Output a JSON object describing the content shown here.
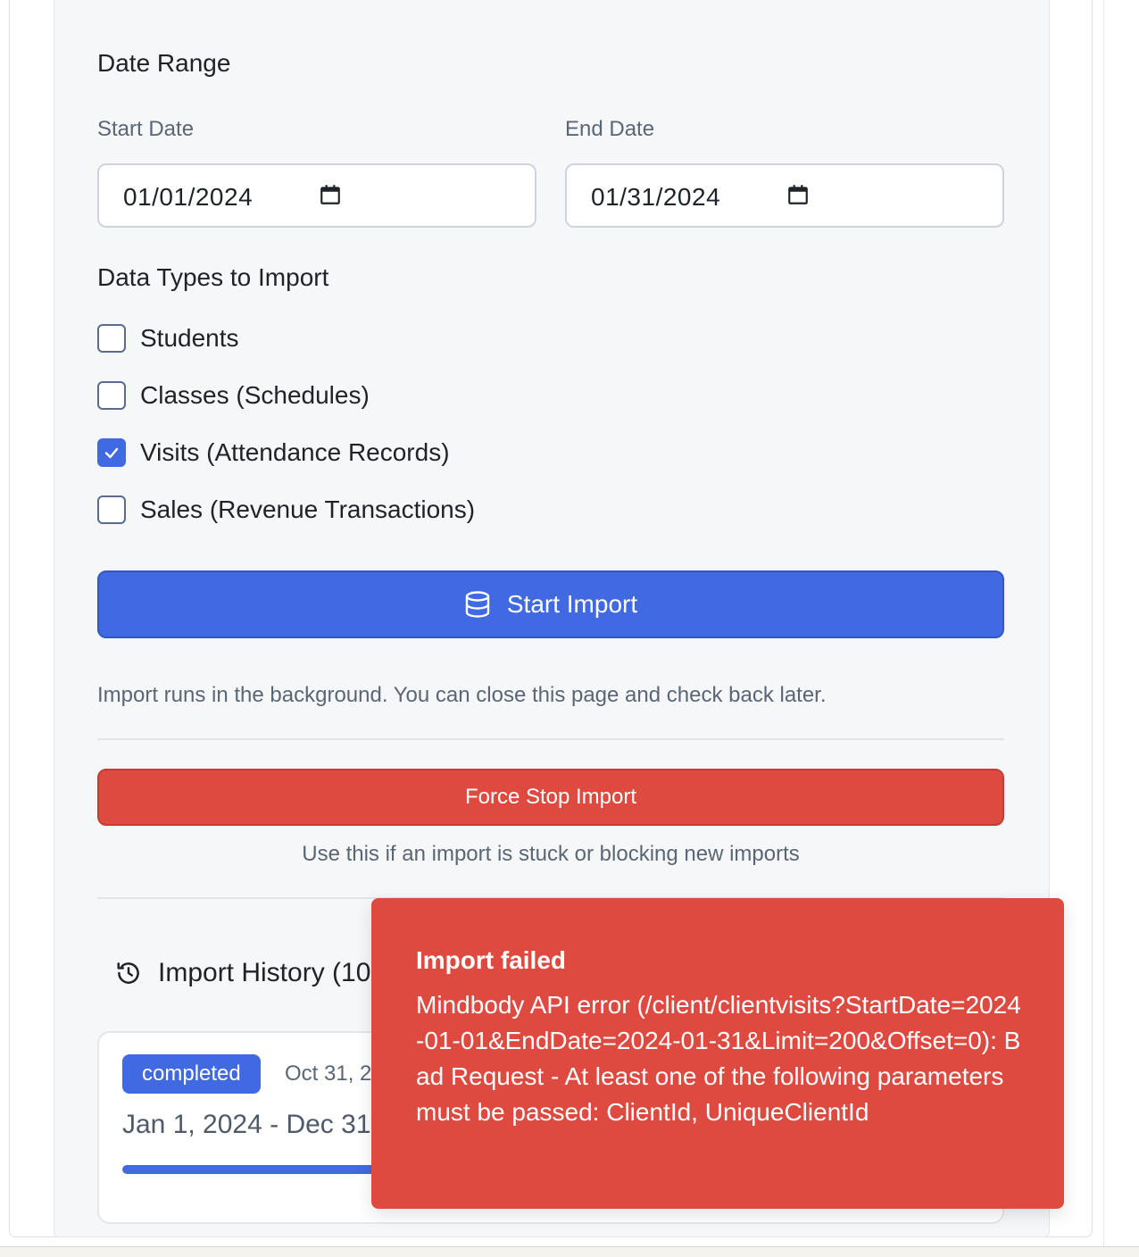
{
  "date_range": {
    "title": "Date Range",
    "start_label": "Start Date",
    "start_value": "01/01/2024",
    "end_label": "End Date",
    "end_value": "01/31/2024"
  },
  "data_types": {
    "title": "Data Types to Import",
    "items": [
      {
        "label": "Students",
        "checked": false
      },
      {
        "label": "Classes (Schedules)",
        "checked": false
      },
      {
        "label": "Visits (Attendance Records)",
        "checked": true
      },
      {
        "label": "Sales (Revenue Transactions)",
        "checked": false
      }
    ]
  },
  "start_button": {
    "label": "Start Import",
    "icon": "database-icon"
  },
  "background_hint": "Import runs in the background. You can close this page and check back later.",
  "force_stop": {
    "label": "Force Stop Import",
    "hint": "Use this if an import is stuck or blocking new imports"
  },
  "history": {
    "title": "Import History (10",
    "icon": "history-icon",
    "card": {
      "status": "completed",
      "date": "Oct 31, 2",
      "range": "Jan 1, 2024 - Dec 31,",
      "progress": 1.0
    }
  },
  "toast": {
    "title": "Import failed",
    "message": "Mindbody API error (/client/clientvisits?StartDate=2024-01-01&EndDate=2024-01-31&Limit=200&Offset=0): Bad Request - At least one of the following parameters must be passed: ClientId, UniqueClientId"
  },
  "colors": {
    "primary": "#4169e1",
    "danger": "#de4a40",
    "panel_bg": "#f6f7f9"
  }
}
